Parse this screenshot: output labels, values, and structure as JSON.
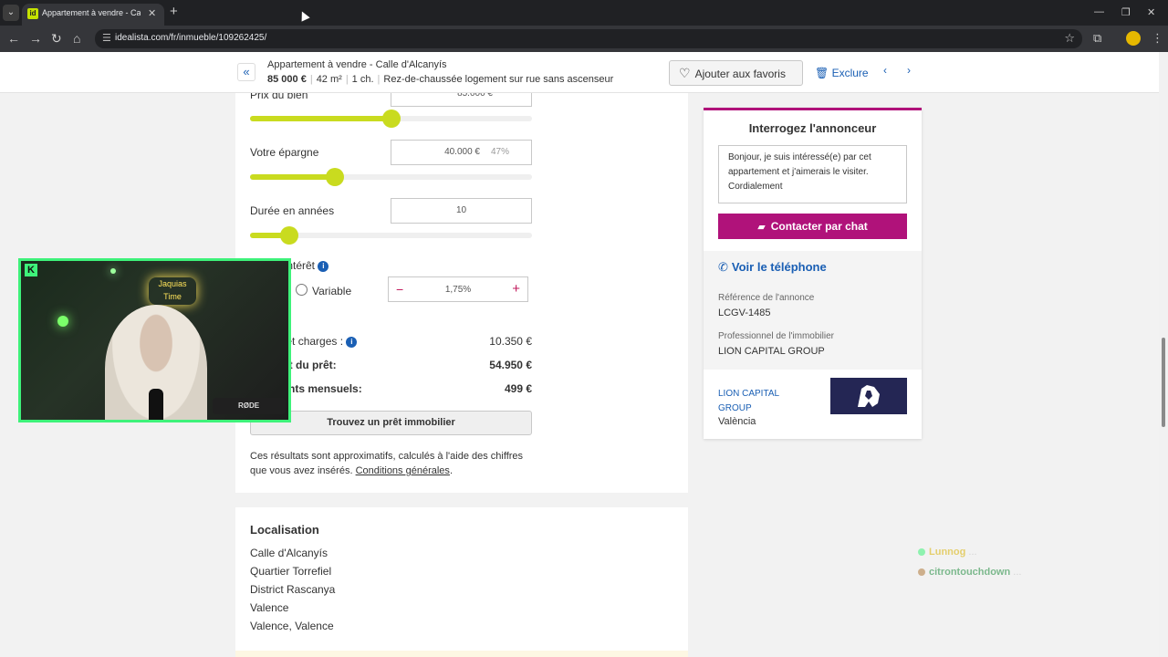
{
  "browser": {
    "tab_title": "Appartement à vendre - Calle d'Alcanyís",
    "url": "idealista.com/fr/inmueble/109262425/"
  },
  "sticky": {
    "title": "Appartement à vendre - Calle d'Alcanyís",
    "price": "85 000 €",
    "area": "42 m²",
    "rooms": "1 ch.",
    "description": "Rez-de-chaussée logement sur rue sans ascenseur",
    "fav_label": "Ajouter aux favoris",
    "exclude_label": "Exclure"
  },
  "calculator": {
    "price_label": "Prix du bien",
    "price_value": "85.000 €",
    "price_slider_pct": 50,
    "savings_label": "Votre épargne",
    "savings_value": "40.000 €",
    "savings_pct": "47%",
    "savings_slider_pct": 30,
    "duration_label": "Durée en années",
    "duration_value": "10",
    "duration_slider_pct": 14,
    "rate_label": "Taux d'intérêt",
    "rate_type_variable": "Variable",
    "rate_value": "1,75%",
    "taxes_label": "Impôts et charges :",
    "taxes_value": "10.350 €",
    "loan_amount_label": "Montant du prêt:",
    "loan_amount_value": "54.950 €",
    "monthly_label": "Paiements mensuels:",
    "monthly_value": "499 €",
    "find_loan_label": "Trouvez un prêt immobilier",
    "disclaimer": "Ces résultats sont approximatifs, calculés à l'aide des chiffres que vous avez insérés.",
    "conditions_link": "Conditions générales"
  },
  "location": {
    "title": "Localisation",
    "lines": [
      "Calle d'Alcanyís",
      "Quartier Torrefiel",
      "District Rascanya",
      "Valence",
      "Valence, Valence"
    ]
  },
  "contact": {
    "title": "Interrogez l'annonceur",
    "message": "Bonjour, je suis intéressé(e) par cet appartement et j'aimerais le visiter. Cordialement",
    "chat_label": "Contacter par chat",
    "phone_label": "Voir le téléphone",
    "ref_label": "Référence de l'annonce",
    "ref_value": "LCGV-1485",
    "pro_label": "Professionnel de l'immobilier",
    "pro_value": "LION CAPITAL GROUP",
    "agency_name": "LION CAPITAL GROUP",
    "agency_city": "València"
  },
  "stream": {
    "cam_sign": "Jaquias Time",
    "lamp_brand": "RØDE",
    "chat": [
      {
        "user": "Lunnog",
        "text": "..."
      },
      {
        "user": "citrontouchdown",
        "text": "..."
      }
    ]
  },
  "colors": {
    "accent_lime": "#c9db1f",
    "brand_magenta": "#b0127a",
    "link_blue": "#1a5fb4",
    "cam_border": "#3ef27a"
  }
}
